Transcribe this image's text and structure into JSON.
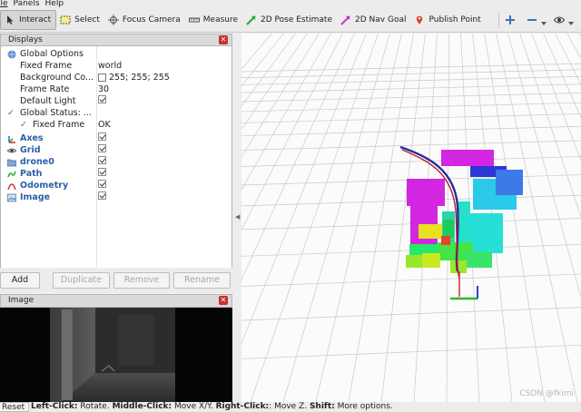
{
  "menu": {
    "file_tail": "ile",
    "panels": "Panels",
    "help": "Help"
  },
  "toolbar": {
    "interact": "Interact",
    "select": "Select",
    "focus_camera": "Focus Camera",
    "measure": "Measure",
    "pose_estimate": "2D Pose Estimate",
    "nav_goal": "2D Nav Goal",
    "publish_point": "Publish Point"
  },
  "displays": {
    "title": "Displays",
    "global_options": "Global Options",
    "fixed_frame_label": "Fixed Frame",
    "fixed_frame_value": "world",
    "background_label": "Background Co...",
    "background_value": "255; 255; 255",
    "frame_rate_label": "Frame Rate",
    "frame_rate_value": "30",
    "default_light_label": "Default Light",
    "global_status_label": "Global Status: ...",
    "fixed_frame_status_label": "Fixed Frame",
    "fixed_frame_status_value": "OK",
    "items": [
      {
        "label": "Axes"
      },
      {
        "label": "Grid"
      },
      {
        "label": "drone0"
      },
      {
        "label": "Path"
      },
      {
        "label": "Odometry"
      },
      {
        "label": "Image"
      }
    ]
  },
  "buttons": {
    "add": "Add",
    "duplicate": "Duplicate",
    "remove": "Remove",
    "rename": "Rename"
  },
  "image_panel": {
    "title": "Image"
  },
  "status": {
    "reset": "Reset",
    "left_click": "Left-Click:",
    "left_click_action": " Rotate. ",
    "middle_click": "Middle-Click:",
    "middle_click_action": " Move X/Y. ",
    "right_click": "Right-Click:",
    "right_click_action": ": Move Z. ",
    "shift": "Shift:",
    "shift_action": " More options."
  },
  "watermark": "CSDN @fkimi",
  "colors": {
    "accent_blue": "#2d5fa8",
    "close_red": "#c8302f",
    "path_blue": "#1f2fa0",
    "path_red": "#c0182a"
  }
}
